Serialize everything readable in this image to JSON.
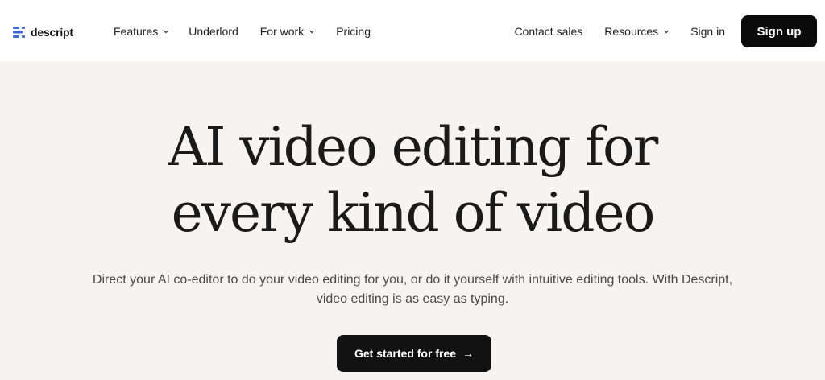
{
  "brand": {
    "name": "descript",
    "logo_icon": "descript-logo-icon",
    "accent": "#3b66f5"
  },
  "nav": {
    "left": [
      {
        "label": "Features",
        "dropdown": true
      },
      {
        "label": "Underlord",
        "dropdown": false
      },
      {
        "label": "For work",
        "dropdown": true
      },
      {
        "label": "Pricing",
        "dropdown": false
      }
    ],
    "right": [
      {
        "label": "Contact sales",
        "dropdown": false
      },
      {
        "label": "Resources",
        "dropdown": true
      },
      {
        "label": "Sign in",
        "dropdown": false
      }
    ],
    "signup_label": "Sign up"
  },
  "hero": {
    "title_line1": "AI video editing for",
    "title_line2": "every kind of video",
    "subtitle": "Direct your AI co-editor to do your video editing for you, or do it yourself with intuitive editing tools. With Descript, video editing is as easy as typing.",
    "cta_label": "Get started for free",
    "cta_icon": "arrow-right-icon"
  },
  "colors": {
    "page_bg": "#f5f4f2",
    "nav_bg": "#ffffff",
    "button_bg": "#0b0b0b",
    "text": "#1a1a1a",
    "subtext": "#4a4a4a"
  }
}
